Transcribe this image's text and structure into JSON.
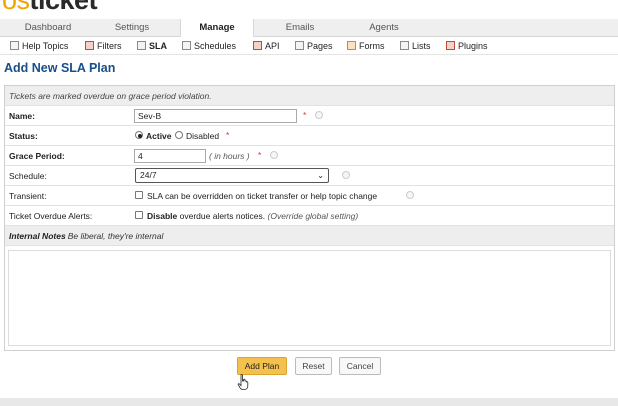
{
  "logo": {
    "prefix": "os",
    "name": "ticket"
  },
  "main_nav": {
    "tabs": [
      {
        "label": "Dashboard"
      },
      {
        "label": "Settings"
      },
      {
        "label": "Manage",
        "active": true
      },
      {
        "label": "Emails"
      },
      {
        "label": "Agents"
      }
    ]
  },
  "sub_nav": {
    "items": [
      {
        "label": "Help Topics",
        "icon": "help-topics-icon"
      },
      {
        "label": "Filters",
        "icon": "filters-icon"
      },
      {
        "label": "SLA",
        "icon": "sla-icon",
        "active": true
      },
      {
        "label": "Schedules",
        "icon": "schedules-icon"
      },
      {
        "label": "API",
        "icon": "api-icon"
      },
      {
        "label": "Pages",
        "icon": "pages-icon"
      },
      {
        "label": "Forms",
        "icon": "forms-icon"
      },
      {
        "label": "Lists",
        "icon": "lists-icon"
      },
      {
        "label": "Plugins",
        "icon": "plugins-icon"
      }
    ]
  },
  "page_title": "Add New SLA Plan",
  "form": {
    "note": "Tickets are marked overdue on grace period violation.",
    "name": {
      "label": "Name:",
      "value": "Sev-B",
      "required": "*"
    },
    "status": {
      "label": "Status:",
      "active_label": "Active",
      "disabled_label": "Disabled",
      "selected": "Active",
      "required": "*"
    },
    "grace_period": {
      "label": "Grace Period:",
      "value": "4",
      "unit": "( in hours )",
      "required": "*"
    },
    "schedule": {
      "label": "Schedule:",
      "selected": "24/7"
    },
    "transient": {
      "label": "Transient:",
      "text": "SLA can be overridden on ticket transfer or help topic change",
      "checked": false
    },
    "overdue_alerts": {
      "label": "Ticket Overdue Alerts:",
      "bold_text": "Disable",
      "text": "overdue alerts notices.",
      "hint": "(Override global setting)",
      "checked": false
    },
    "internal_notes": {
      "label": "Internal Notes",
      "hint": ": Be liberal, they're internal",
      "value": ""
    }
  },
  "buttons": {
    "add": "Add Plan",
    "reset": "Reset",
    "cancel": "Cancel"
  },
  "colors": {
    "accent": "#f4c14e",
    "title": "#184e8a",
    "required": "#e03030",
    "logo_prefix": "#f0a400"
  }
}
